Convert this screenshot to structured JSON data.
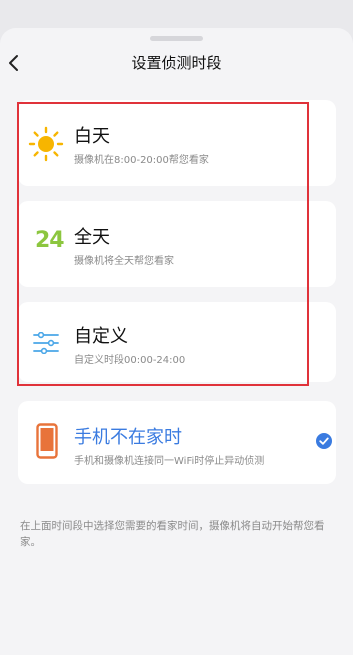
{
  "header": {
    "title": "设置侦测时段",
    "back_icon": "chevron-left-icon"
  },
  "options": [
    {
      "title": "白天",
      "subtitle": "摄像机在8:00-20:00帮您看家",
      "icon": "sun-icon"
    },
    {
      "title": "全天",
      "subtitle": "摄像机将全天帮您看家",
      "icon": "24-hours-icon",
      "icon_text": "24"
    },
    {
      "title": "自定义",
      "subtitle": "自定义时段00:00-24:00",
      "icon": "sliders-icon"
    }
  ],
  "phone_away": {
    "title": "手机不在家时",
    "subtitle": "手机和摄像机连接同一WiFi时停止异动侦测",
    "icon": "phone-icon",
    "selected": true
  },
  "note": "在上面时间段中选择您需要的看家时间，摄像机将自动开始帮您看家。",
  "colors": {
    "accent": "#3a7be0",
    "highlight_border": "#e0323a",
    "sun": "#f7b500",
    "hours24": "#8cc63f",
    "phone": "#e8733a"
  }
}
